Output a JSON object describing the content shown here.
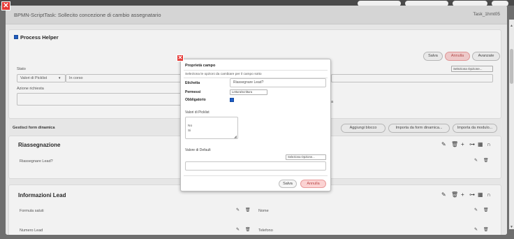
{
  "window": {
    "title": "BPMN-ScriptTask: Sollecito concezione di cambio assegnatario",
    "right_text": "Task_1hmt05"
  },
  "process_helper": {
    "title": "Process Helper",
    "save_label": "Salva",
    "cancel_label": "Annulla",
    "advanced_label": "Avanzate",
    "select_option": "Seleziona Opzione...",
    "stato_label": "Stato",
    "picklist_select": "Valori di Picklist",
    "stato_value": "In corso",
    "action_label": "Azione richiesta",
    "side_text": "a"
  },
  "form_manager": {
    "title": "Gestisci form dinamica",
    "add_block": "Aggiungi blocco",
    "import_dynamic": "Importa da form dinamica...",
    "import_module": "Importa da modulo..."
  },
  "sections": [
    {
      "title": "Riassegnazione",
      "rows": [
        "Riassegnare Lead?"
      ]
    },
    {
      "title": "Informazioni Lead",
      "rows": [
        "Formula saluti",
        "Nome",
        "Numero Lead",
        "Telefono"
      ]
    }
  ],
  "icons": {
    "edit": "✎",
    "trash": "🗑",
    "plus": "+",
    "link": "⊶",
    "grid": "▦",
    "arch": "∩",
    "close": "✕",
    "scroll_up": "▲",
    "scroll_down": "▼"
  },
  "dialog": {
    "title": "Proprietà campo",
    "instructions": "Seleziona le opzioni da cambiare per il campo sotto",
    "label_name": "Etichetta",
    "label_value": "Riassegnare Lead?",
    "permissions_label": "Permessi",
    "permissions_value": "Lettura/scrittura",
    "required_label": "Obbligatorio",
    "picklist_label": "Valori di Picklist",
    "picklist_values": [
      "No",
      "Si"
    ],
    "default_label": "Valore di Default",
    "default_select": "Seleziona Opzione...",
    "save_label": "Salva",
    "cancel_label": "Annulla"
  }
}
